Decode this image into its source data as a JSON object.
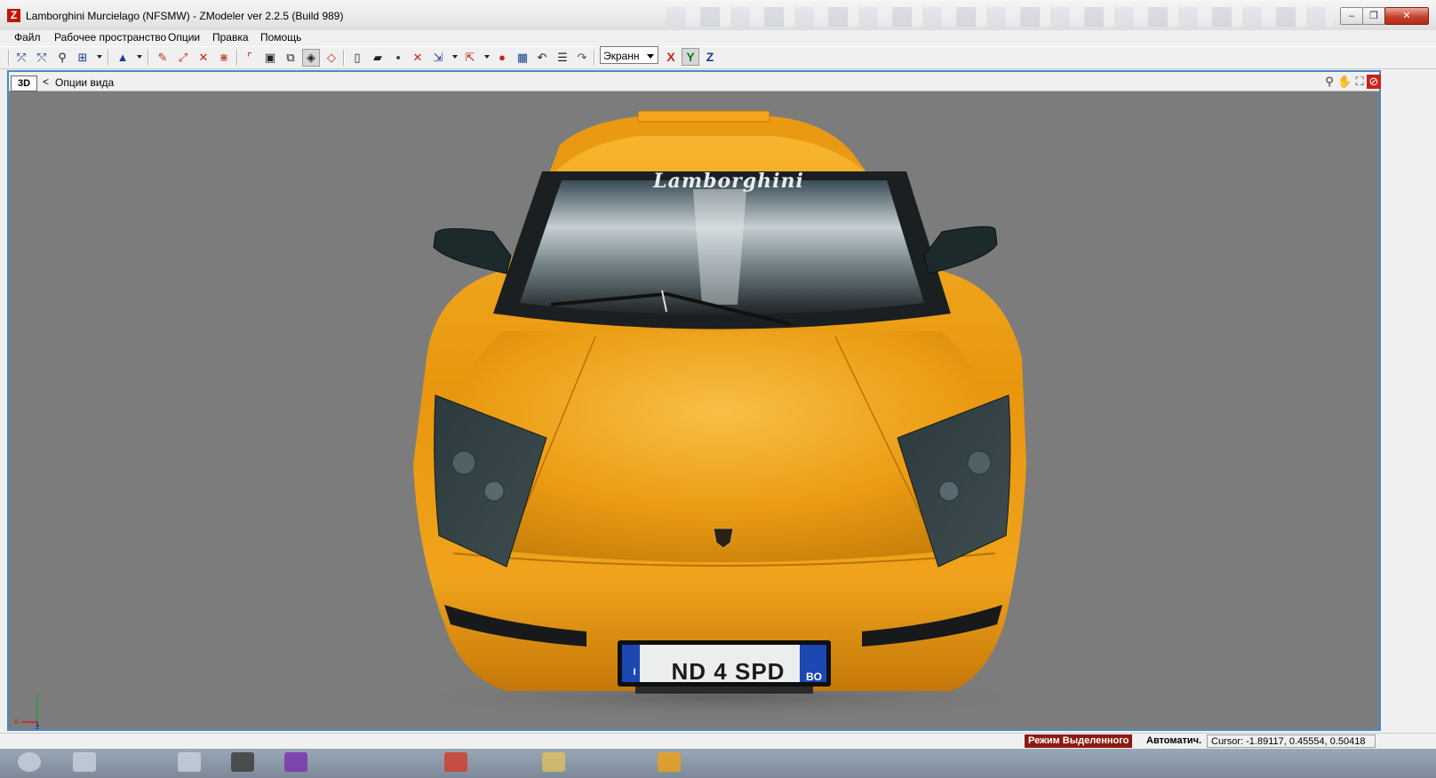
{
  "window": {
    "title": "Lamborghini Murcielago  (NFSMW) - ZModeler ver 2.2.5 (Build 989)",
    "app_icon_letter": "Z",
    "minimize_symbol": "–",
    "maximize_symbol": "❐",
    "close_symbol": "✕"
  },
  "menu": {
    "items": [
      "Файл",
      "Рабочее пространство",
      "Опции",
      "Правка",
      "Помощь"
    ]
  },
  "toolbar": {
    "view_mode": "Экранн",
    "axis_x": "X",
    "axis_y": "Y",
    "axis_z": "Z"
  },
  "viewport": {
    "mode_tag": "3D",
    "chevron": "<",
    "options_label": "Опции вида",
    "brand_lettering": "Lamborghini",
    "plate": {
      "country": "I",
      "number": "ND 4 SPD",
      "province": "BO"
    },
    "gizmo": {
      "x": "x",
      "y": "y",
      "z": "z"
    }
  },
  "status": {
    "mode": "Режим Выделенного",
    "auto": "Автоматич.",
    "cursor": "Cursor: -1.89117, 0.45554, 0.50418"
  },
  "colors": {
    "viewport_bg": "#7c7c7c",
    "car_body": "#f0a017",
    "mode_badge": "#8b1a10",
    "frame_accent": "#4d88c8"
  }
}
